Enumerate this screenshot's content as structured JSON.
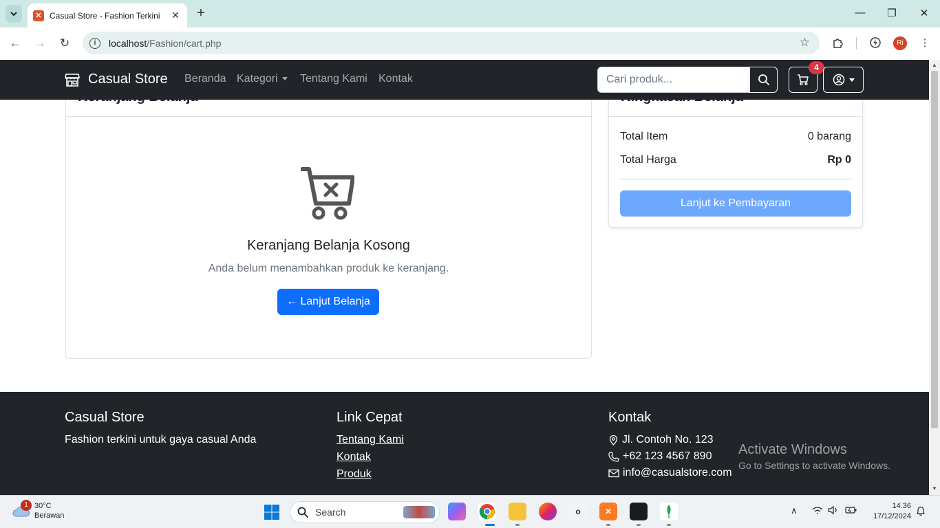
{
  "browser": {
    "tab_title": "Casual Store - Fashion Terkini",
    "url_host": "localhost",
    "url_path": "/Fashion/cart.php",
    "profile_initials": "Ri"
  },
  "navbar": {
    "brand": "Casual Store",
    "links": [
      "Beranda",
      "Kategori",
      "Tentang Kami",
      "Kontak"
    ],
    "search_placeholder": "Cari produk...",
    "cart_count": "4"
  },
  "cart": {
    "header_title": "Keranjang Belanja",
    "empty_title": "Keranjang Belanja Kosong",
    "empty_message": "Anda belum menambahkan produk ke keranjang.",
    "continue_label": "← Lanjut Belanja"
  },
  "summary": {
    "header_title": "Ringkasan Belanja",
    "total_item_label": "Total Item",
    "total_item_value": "0 barang",
    "total_price_label": "Total Harga",
    "total_price_value": "Rp 0",
    "checkout_label": "Lanjut ke Pembayaran"
  },
  "footer": {
    "brand": "Casual Store",
    "tagline": "Fashion terkini untuk gaya casual Anda",
    "links_heading": "Link Cepat",
    "links": [
      "Tentang Kami",
      "Kontak",
      "Produk"
    ],
    "contact_heading": "Kontak",
    "address": "Jl. Contoh No. 123",
    "phone": "+62 123 4567 890",
    "email": "info@casualstore.com"
  },
  "watermark": {
    "title": "Activate Windows",
    "subtitle": "Go to Settings to activate Windows."
  },
  "taskbar": {
    "weather_temp": "30°C",
    "weather_desc": "Berawan",
    "weather_badge": "1",
    "search_label": "Search",
    "time": "14.36",
    "date": "17/12/2024"
  },
  "colors": {
    "navbar_bg": "#212529",
    "primary": "#0d6efd",
    "primary_disabled": "#6ea8fe",
    "badge": "#dc3545",
    "tabbar_bg": "#cfe9e6"
  }
}
